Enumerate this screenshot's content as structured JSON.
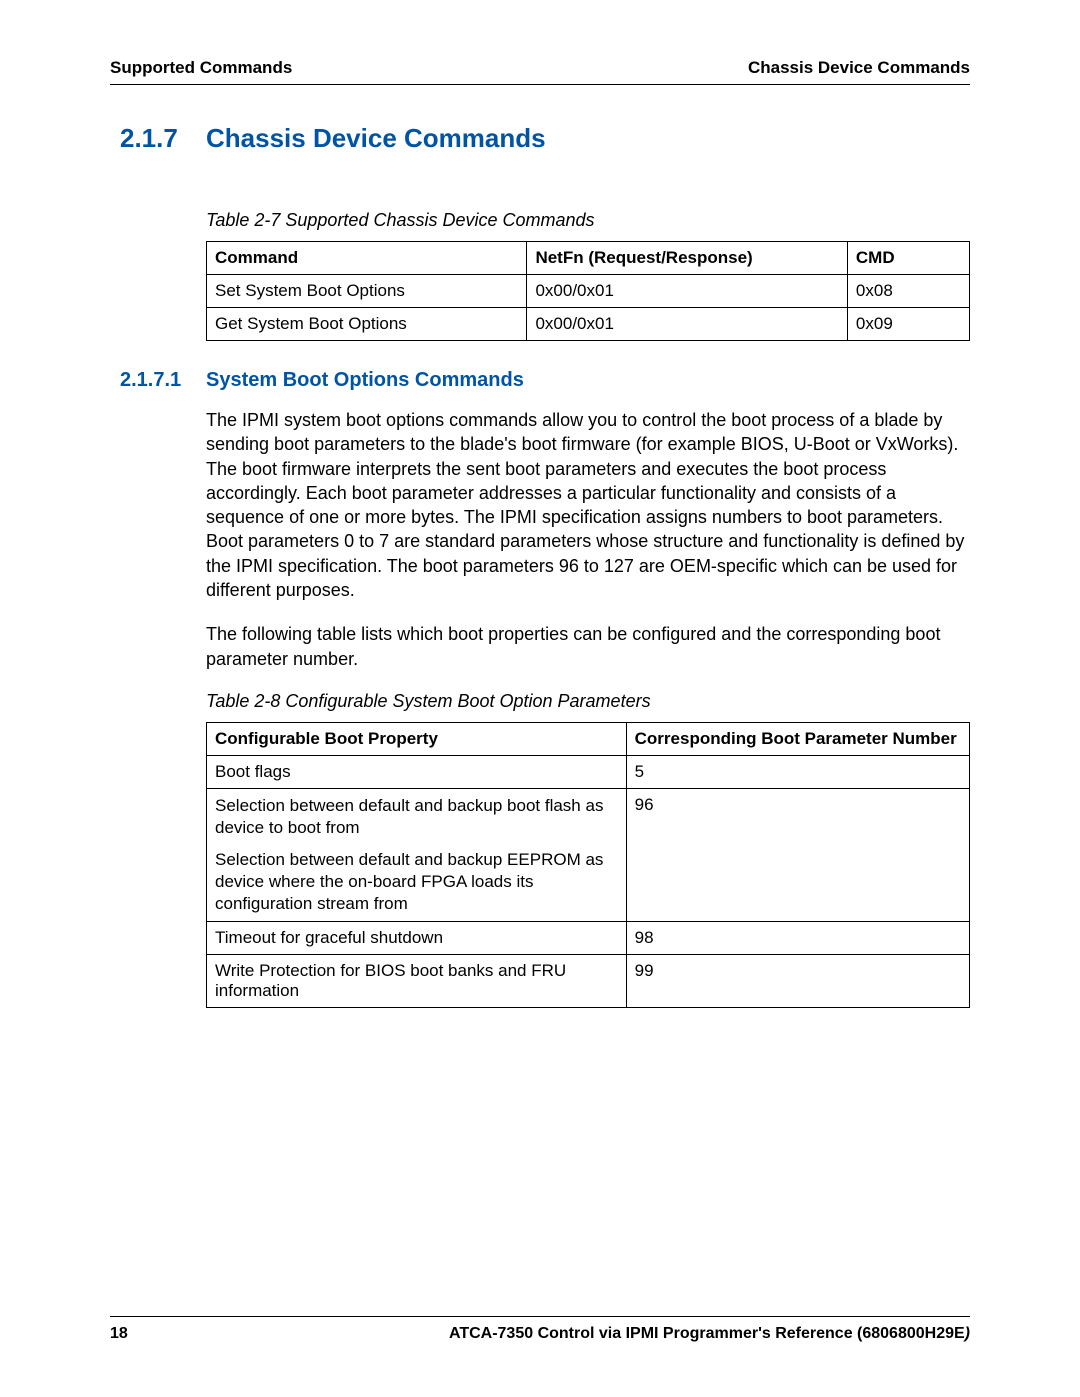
{
  "header": {
    "left": "Supported Commands",
    "right": "Chassis Device Commands"
  },
  "section": {
    "number": "2.1.7",
    "title": "Chassis Device Commands"
  },
  "table1": {
    "caption": "Table 2-7 Supported Chassis Device Commands",
    "headers": [
      "Command",
      "NetFn (Request/Response)",
      "CMD"
    ],
    "rows": [
      [
        "Set System Boot Options",
        "0x00/0x01",
        "0x08"
      ],
      [
        "Get System Boot Options",
        "0x00/0x01",
        "0x09"
      ]
    ]
  },
  "subsection": {
    "number": "2.1.7.1",
    "title": "System Boot Options Commands",
    "para1": "The IPMI system boot options commands allow you to control the boot process of a blade by sending boot parameters to the blade's boot firmware (for example BIOS, U-Boot or VxWorks). The boot firmware interprets the sent boot parameters and executes the boot process accordingly. Each boot parameter addresses a particular functionality and consists of a sequence of one or more bytes. The IPMI specification assigns numbers to boot parameters. Boot parameters 0 to 7 are standard parameters whose structure and functionality is defined by the IPMI specification. The boot parameters 96 to 127 are OEM-specific which can be used for different purposes.",
    "para2": "The following table lists which boot properties can be configured and the corresponding boot parameter number."
  },
  "table2": {
    "caption": "Table 2-8 Configurable System Boot Option Parameters",
    "headers": [
      "Configurable Boot Property",
      "Corresponding Boot Parameter Number"
    ],
    "rows": [
      {
        "property": "Boot flags",
        "number": "5"
      },
      {
        "property_multi": [
          "Selection between default and backup boot flash as device to boot from",
          "Selection between default and backup EEPROM as device where the on-board FPGA loads its configuration stream from"
        ],
        "number": "96"
      },
      {
        "property": "Timeout for graceful shutdown",
        "number": "98"
      },
      {
        "property": "Write Protection for BIOS boot banks and FRU information",
        "number": "99"
      }
    ]
  },
  "footer": {
    "page": "18",
    "title": "ATCA-7350 Control via IPMI Programmer's Reference (6806800H29E",
    "close": ")"
  }
}
